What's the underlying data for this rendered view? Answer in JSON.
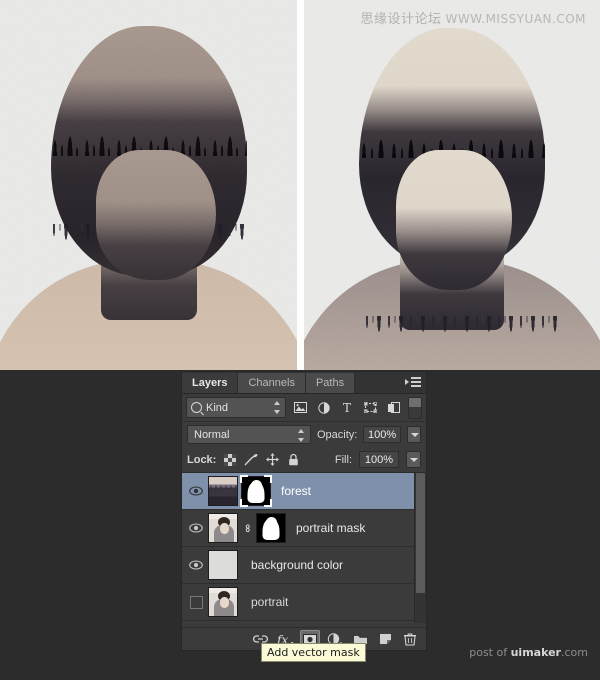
{
  "artwork": {
    "left_image_alt": "double-exposure portrait with forest",
    "right_image_alt": "double-exposure portrait with forest, lighter sky",
    "watermark_cn": "思缘设计论坛",
    "watermark_url": "WWW.MISSYUAN.COM"
  },
  "credit": {
    "prefix": "post of ",
    "brand": "uimaker",
    "suffix": ".com"
  },
  "panel": {
    "tabs": [
      {
        "label": "Layers",
        "active": true
      },
      {
        "label": "Channels",
        "active": false
      },
      {
        "label": "Paths",
        "active": false
      }
    ],
    "menu_icon": "panel-menu-icon",
    "filter": {
      "search_icon": "search-icon",
      "kind_value": "Kind",
      "type_icons": [
        "pixel-layer-filter-icon",
        "adjustment-layer-filter-icon",
        "type-layer-filter-icon",
        "shape-layer-filter-icon",
        "smart-object-filter-icon"
      ],
      "toggle_name": "filter-enable-toggle"
    },
    "blend": {
      "mode_value": "Normal",
      "opacity_label": "Opacity:",
      "opacity_value": "100%",
      "fill_label": "Fill:",
      "fill_value": "100%"
    },
    "lock": {
      "label": "Lock:",
      "items": [
        "lock-transparent-pixels-icon",
        "lock-image-pixels-icon",
        "lock-position-icon",
        "lock-all-icon"
      ]
    },
    "layers": [
      {
        "name": "forest",
        "visible": true,
        "selected": true,
        "thumb": "forest-thumbnail",
        "mask": "layer-mask-thumbnail",
        "mask_active": true,
        "linked": false
      },
      {
        "name": "portrait mask",
        "visible": true,
        "selected": false,
        "thumb": "portrait-thumbnail",
        "mask": "layer-mask-thumbnail",
        "mask_active": false,
        "linked": true
      },
      {
        "name": "background color",
        "visible": true,
        "selected": false,
        "thumb": "solid-color-thumbnail",
        "mask": null,
        "mask_active": false,
        "linked": false
      },
      {
        "name": "portrait",
        "visible": false,
        "selected": false,
        "thumb": "portrait-thumbnail",
        "mask": null,
        "mask_active": false,
        "linked": false
      }
    ],
    "footer_buttons": [
      {
        "name": "link-layers-button",
        "pressed": false
      },
      {
        "name": "layer-style-fx-button",
        "pressed": false
      },
      {
        "name": "add-layer-mask-button",
        "pressed": true
      },
      {
        "name": "new-fill-adjustment-layer-button",
        "pressed": false
      },
      {
        "name": "new-group-button",
        "pressed": false
      },
      {
        "name": "new-layer-button",
        "pressed": false
      },
      {
        "name": "delete-layer-button",
        "pressed": false
      }
    ]
  },
  "tooltip": {
    "text": "Add vector mask"
  },
  "colors": {
    "selection_blue": "#7f90ab",
    "panel_bg": "#3b3b3b",
    "chrome_bg": "#2c2c2c",
    "tooltip_bg": "#fbfbd8"
  }
}
